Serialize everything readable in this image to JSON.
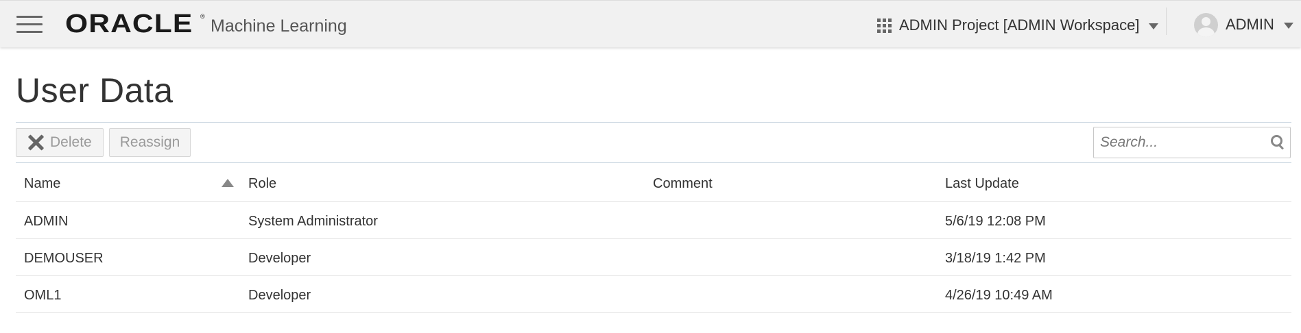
{
  "header": {
    "brand": "ORACLE",
    "brand_mark": "®",
    "app_name": "Machine Learning",
    "project_selector": "ADMIN Project [ADMIN Workspace]",
    "user_name": "ADMIN",
    "icons": [
      "hamburger-menu-icon",
      "grid-icon",
      "chevron-down-icon",
      "avatar-icon"
    ]
  },
  "page": {
    "title": "User Data"
  },
  "toolbar": {
    "delete_label": "Delete",
    "reassign_label": "Reassign",
    "search_placeholder": "Search..."
  },
  "table": {
    "columns": [
      "Name",
      "Role",
      "Comment",
      "Last Update"
    ],
    "sort": {
      "column": "Name",
      "direction": "ascending"
    },
    "rows": [
      {
        "name": "ADMIN",
        "role": "System Administrator",
        "comment": "",
        "last_update": "5/6/19 12:08 PM"
      },
      {
        "name": "DEMOUSER",
        "role": "Developer",
        "comment": "",
        "last_update": "3/18/19 1:42 PM"
      },
      {
        "name": "OML1",
        "role": "Developer",
        "comment": "",
        "last_update": "4/26/19 10:49 AM"
      }
    ]
  },
  "colors": {
    "header_bg": "#f1f1f1",
    "text": "#333333",
    "disabled_text": "#9a9a9a",
    "divider": "#c9d5e0"
  }
}
